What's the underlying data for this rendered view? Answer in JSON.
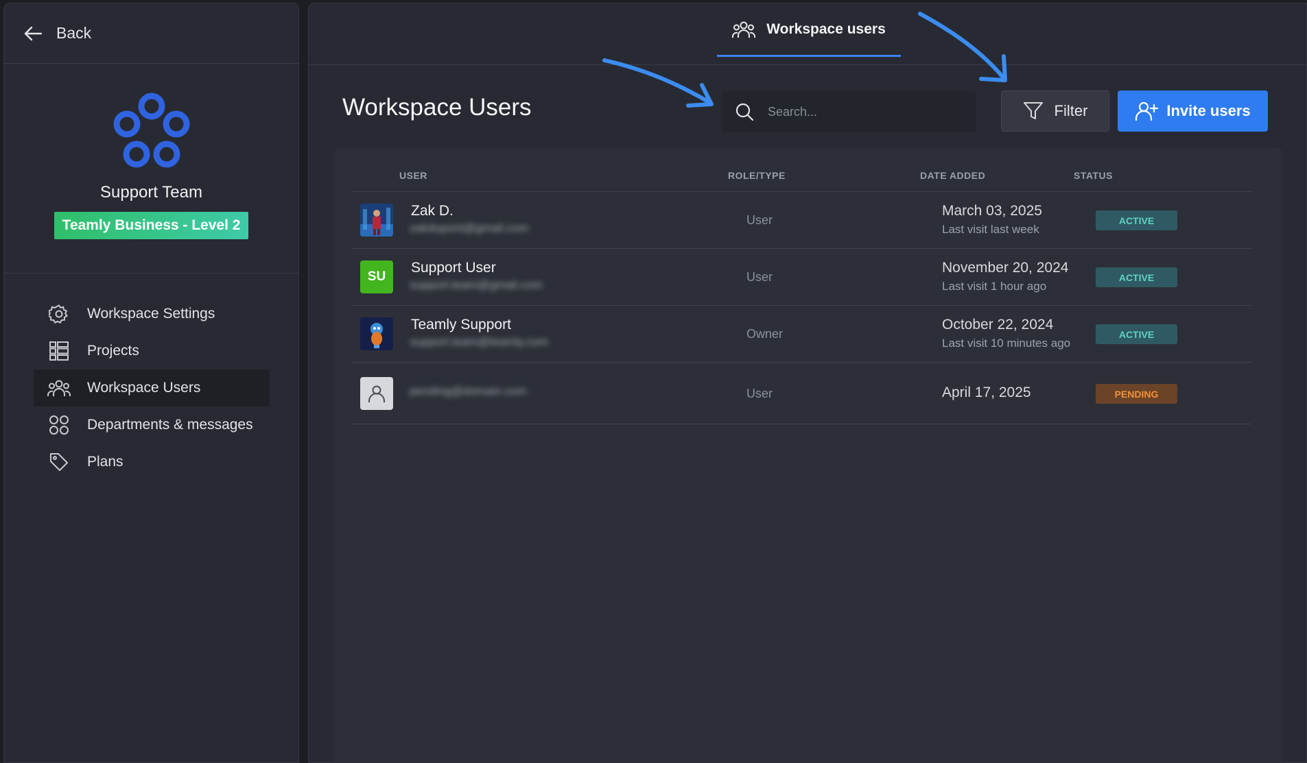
{
  "sidebar": {
    "back_label": "Back",
    "workspace_name": "Support Team",
    "plan_badge": "Teamly Business - Level 2",
    "items": [
      {
        "label": "Workspace Settings",
        "icon": "gear-icon"
      },
      {
        "label": "Projects",
        "icon": "grid-list-icon"
      },
      {
        "label": "Workspace Users",
        "icon": "users-icon",
        "active": true
      },
      {
        "label": "Departments & messages",
        "icon": "four-circles-icon"
      },
      {
        "label": "Plans",
        "icon": "tag-icon"
      }
    ]
  },
  "header": {
    "tab_label": "Workspace users"
  },
  "main": {
    "title": "Workspace Users",
    "search_placeholder": "Search...",
    "filter_label": "Filter",
    "invite_label": "Invite users"
  },
  "table": {
    "columns": [
      "USER",
      "ROLE/TYPE",
      "DATE ADDED",
      "STATUS"
    ],
    "rows": [
      {
        "name": "Zak D.",
        "email": "zakdupont@gmail.com",
        "role": "User",
        "date": "March 03, 2025",
        "visit": "Last visit last week",
        "status": "ACTIVE"
      },
      {
        "name": "Support User",
        "initials": "SU",
        "email": "support.team@gmail.com",
        "role": "User",
        "date": "November 20, 2024",
        "visit": "Last visit 1 hour ago",
        "status": "ACTIVE"
      },
      {
        "name": "Teamly Support",
        "email": "support.team@teamly.com",
        "role": "Owner",
        "date": "October 22, 2024",
        "visit": "Last visit 10 minutes ago",
        "status": "ACTIVE"
      },
      {
        "name": "",
        "email": "pending@domain.com",
        "role": "User",
        "date": "April 17, 2025",
        "visit": "",
        "status": "PENDING"
      }
    ]
  },
  "colors": {
    "accent": "#2f7cf0",
    "brand_logo": "#2f63e0",
    "active_badge": "#5fd3c4",
    "pending_badge": "#f0923c",
    "annotation_arrow": "#3b8cf0"
  }
}
